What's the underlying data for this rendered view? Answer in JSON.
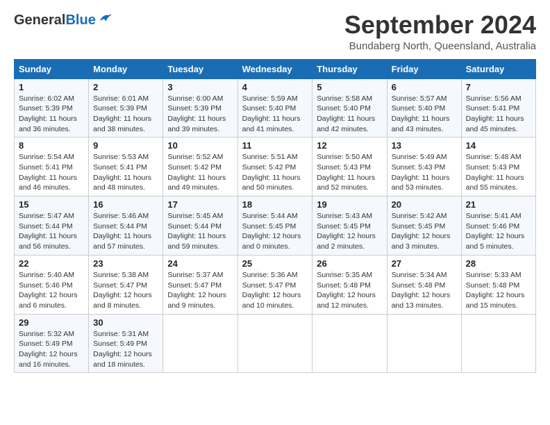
{
  "header": {
    "logo_general": "General",
    "logo_blue": "Blue",
    "month_title": "September 2024",
    "location": "Bundaberg North, Queensland, Australia"
  },
  "calendar": {
    "weekdays": [
      "Sunday",
      "Monday",
      "Tuesday",
      "Wednesday",
      "Thursday",
      "Friday",
      "Saturday"
    ],
    "weeks": [
      [
        {
          "day": "1",
          "sunrise": "Sunrise: 6:02 AM",
          "sunset": "Sunset: 5:39 PM",
          "daylight": "Daylight: 11 hours and 36 minutes."
        },
        {
          "day": "2",
          "sunrise": "Sunrise: 6:01 AM",
          "sunset": "Sunset: 5:39 PM",
          "daylight": "Daylight: 11 hours and 38 minutes."
        },
        {
          "day": "3",
          "sunrise": "Sunrise: 6:00 AM",
          "sunset": "Sunset: 5:39 PM",
          "daylight": "Daylight: 11 hours and 39 minutes."
        },
        {
          "day": "4",
          "sunrise": "Sunrise: 5:59 AM",
          "sunset": "Sunset: 5:40 PM",
          "daylight": "Daylight: 11 hours and 41 minutes."
        },
        {
          "day": "5",
          "sunrise": "Sunrise: 5:58 AM",
          "sunset": "Sunset: 5:40 PM",
          "daylight": "Daylight: 11 hours and 42 minutes."
        },
        {
          "day": "6",
          "sunrise": "Sunrise: 5:57 AM",
          "sunset": "Sunset: 5:40 PM",
          "daylight": "Daylight: 11 hours and 43 minutes."
        },
        {
          "day": "7",
          "sunrise": "Sunrise: 5:56 AM",
          "sunset": "Sunset: 5:41 PM",
          "daylight": "Daylight: 11 hours and 45 minutes."
        }
      ],
      [
        {
          "day": "8",
          "sunrise": "Sunrise: 5:54 AM",
          "sunset": "Sunset: 5:41 PM",
          "daylight": "Daylight: 11 hours and 46 minutes."
        },
        {
          "day": "9",
          "sunrise": "Sunrise: 5:53 AM",
          "sunset": "Sunset: 5:41 PM",
          "daylight": "Daylight: 11 hours and 48 minutes."
        },
        {
          "day": "10",
          "sunrise": "Sunrise: 5:52 AM",
          "sunset": "Sunset: 5:42 PM",
          "daylight": "Daylight: 11 hours and 49 minutes."
        },
        {
          "day": "11",
          "sunrise": "Sunrise: 5:51 AM",
          "sunset": "Sunset: 5:42 PM",
          "daylight": "Daylight: 11 hours and 50 minutes."
        },
        {
          "day": "12",
          "sunrise": "Sunrise: 5:50 AM",
          "sunset": "Sunset: 5:43 PM",
          "daylight": "Daylight: 11 hours and 52 minutes."
        },
        {
          "day": "13",
          "sunrise": "Sunrise: 5:49 AM",
          "sunset": "Sunset: 5:43 PM",
          "daylight": "Daylight: 11 hours and 53 minutes."
        },
        {
          "day": "14",
          "sunrise": "Sunrise: 5:48 AM",
          "sunset": "Sunset: 5:43 PM",
          "daylight": "Daylight: 11 hours and 55 minutes."
        }
      ],
      [
        {
          "day": "15",
          "sunrise": "Sunrise: 5:47 AM",
          "sunset": "Sunset: 5:44 PM",
          "daylight": "Daylight: 11 hours and 56 minutes."
        },
        {
          "day": "16",
          "sunrise": "Sunrise: 5:46 AM",
          "sunset": "Sunset: 5:44 PM",
          "daylight": "Daylight: 11 hours and 57 minutes."
        },
        {
          "day": "17",
          "sunrise": "Sunrise: 5:45 AM",
          "sunset": "Sunset: 5:44 PM",
          "daylight": "Daylight: 11 hours and 59 minutes."
        },
        {
          "day": "18",
          "sunrise": "Sunrise: 5:44 AM",
          "sunset": "Sunset: 5:45 PM",
          "daylight": "Daylight: 12 hours and 0 minutes."
        },
        {
          "day": "19",
          "sunrise": "Sunrise: 5:43 AM",
          "sunset": "Sunset: 5:45 PM",
          "daylight": "Daylight: 12 hours and 2 minutes."
        },
        {
          "day": "20",
          "sunrise": "Sunrise: 5:42 AM",
          "sunset": "Sunset: 5:45 PM",
          "daylight": "Daylight: 12 hours and 3 minutes."
        },
        {
          "day": "21",
          "sunrise": "Sunrise: 5:41 AM",
          "sunset": "Sunset: 5:46 PM",
          "daylight": "Daylight: 12 hours and 5 minutes."
        }
      ],
      [
        {
          "day": "22",
          "sunrise": "Sunrise: 5:40 AM",
          "sunset": "Sunset: 5:46 PM",
          "daylight": "Daylight: 12 hours and 6 minutes."
        },
        {
          "day": "23",
          "sunrise": "Sunrise: 5:38 AM",
          "sunset": "Sunset: 5:47 PM",
          "daylight": "Daylight: 12 hours and 8 minutes."
        },
        {
          "day": "24",
          "sunrise": "Sunrise: 5:37 AM",
          "sunset": "Sunset: 5:47 PM",
          "daylight": "Daylight: 12 hours and 9 minutes."
        },
        {
          "day": "25",
          "sunrise": "Sunrise: 5:36 AM",
          "sunset": "Sunset: 5:47 PM",
          "daylight": "Daylight: 12 hours and 10 minutes."
        },
        {
          "day": "26",
          "sunrise": "Sunrise: 5:35 AM",
          "sunset": "Sunset: 5:48 PM",
          "daylight": "Daylight: 12 hours and 12 minutes."
        },
        {
          "day": "27",
          "sunrise": "Sunrise: 5:34 AM",
          "sunset": "Sunset: 5:48 PM",
          "daylight": "Daylight: 12 hours and 13 minutes."
        },
        {
          "day": "28",
          "sunrise": "Sunrise: 5:33 AM",
          "sunset": "Sunset: 5:48 PM",
          "daylight": "Daylight: 12 hours and 15 minutes."
        }
      ],
      [
        {
          "day": "29",
          "sunrise": "Sunrise: 5:32 AM",
          "sunset": "Sunset: 5:49 PM",
          "daylight": "Daylight: 12 hours and 16 minutes."
        },
        {
          "day": "30",
          "sunrise": "Sunrise: 5:31 AM",
          "sunset": "Sunset: 5:49 PM",
          "daylight": "Daylight: 12 hours and 18 minutes."
        },
        {
          "day": "",
          "sunrise": "",
          "sunset": "",
          "daylight": ""
        },
        {
          "day": "",
          "sunrise": "",
          "sunset": "",
          "daylight": ""
        },
        {
          "day": "",
          "sunrise": "",
          "sunset": "",
          "daylight": ""
        },
        {
          "day": "",
          "sunrise": "",
          "sunset": "",
          "daylight": ""
        },
        {
          "day": "",
          "sunrise": "",
          "sunset": "",
          "daylight": ""
        }
      ]
    ]
  }
}
